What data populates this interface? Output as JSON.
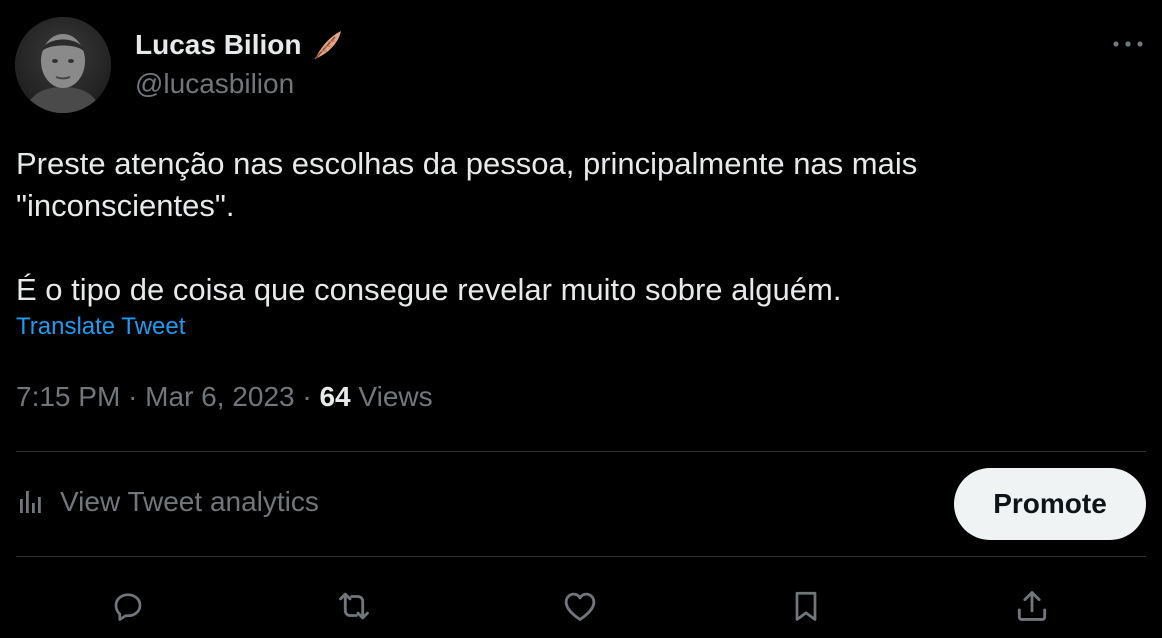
{
  "user": {
    "display_name": "Lucas Bilion",
    "handle": "@lucasbilion",
    "badge_icon": "feather-icon"
  },
  "tweet": {
    "line1": "Preste atenção nas escolhas da pessoa, principalmente nas mais",
    "line2": "\"inconscientes\".",
    "line3": "É o tipo de coisa que consegue revelar muito sobre alguém.",
    "translate_label": "Translate Tweet",
    "time": "7:15 PM",
    "date": "Mar 6, 2023",
    "separator": "·",
    "views_count": "64",
    "views_label": "Views"
  },
  "analytics": {
    "label": "View Tweet analytics",
    "icon": "analytics-icon"
  },
  "promote": {
    "label": "Promote"
  },
  "actions": [
    "reply-icon",
    "retweet-icon",
    "like-icon",
    "bookmark-icon",
    "share-icon"
  ],
  "colors": {
    "background": "#000000",
    "text": "#e7e9ea",
    "muted": "#71767b",
    "link": "#1d9bf0",
    "divider": "#2f3336",
    "promote_bg": "#eff3f4"
  }
}
